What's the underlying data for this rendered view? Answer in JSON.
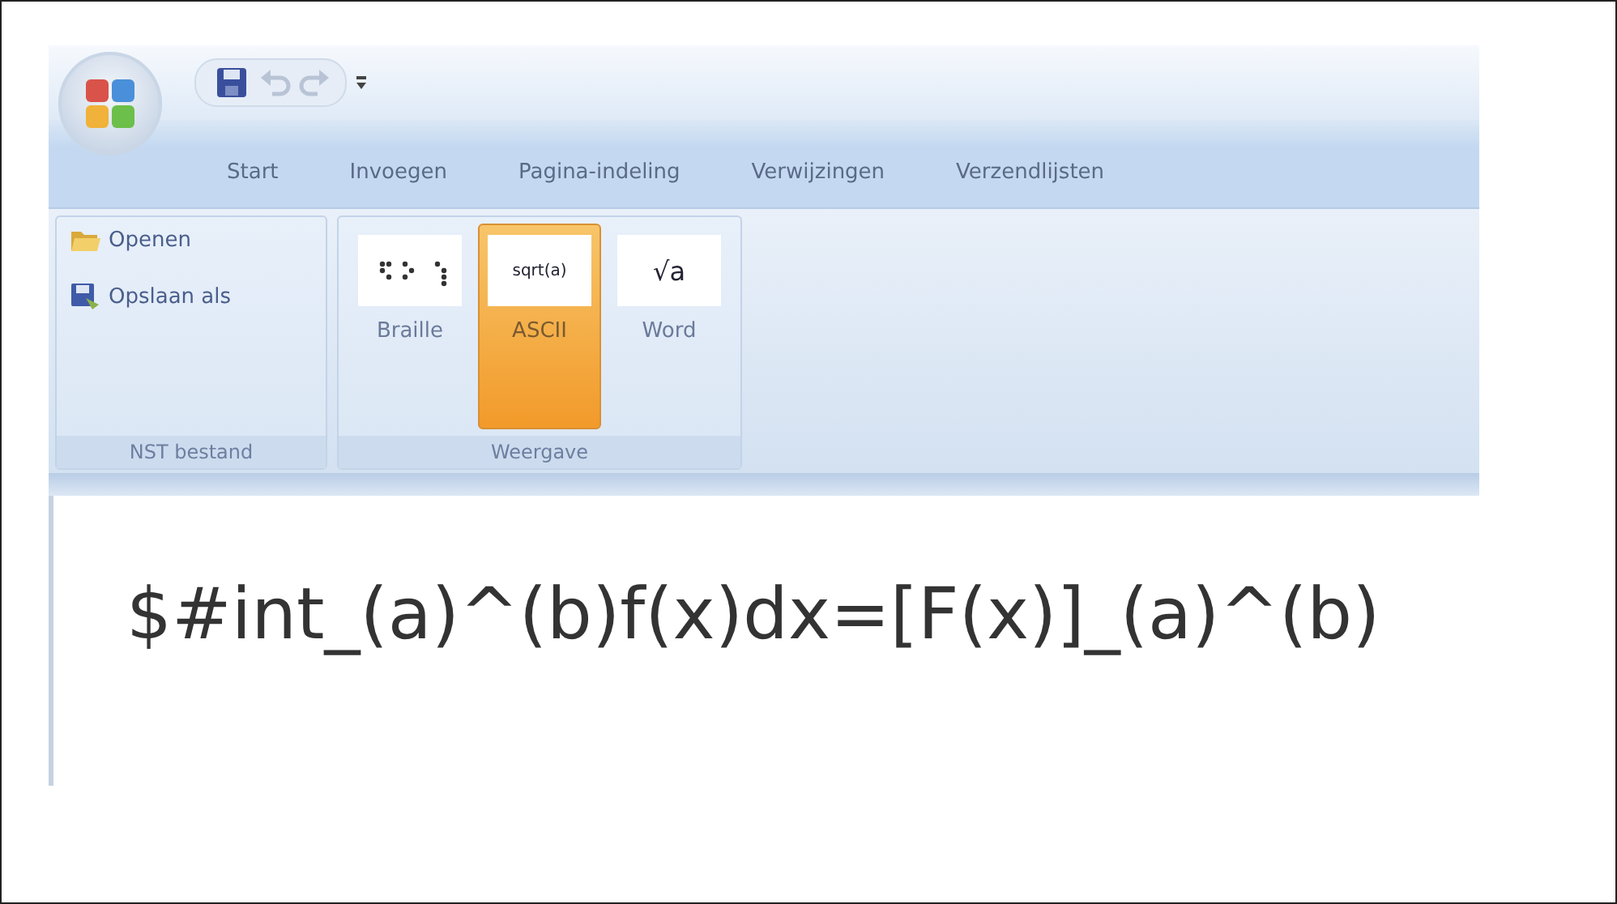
{
  "quick_access": [
    {
      "kind": "save",
      "disabled": false
    },
    {
      "kind": "undo",
      "disabled": true
    },
    {
      "kind": "redo",
      "disabled": true
    },
    {
      "kind": "customize",
      "disabled": false
    }
  ],
  "tabs": [
    {
      "label": "Start",
      "selected": false
    },
    {
      "label": "Invoegen",
      "selected": false
    },
    {
      "label": "Pagina-indeling",
      "selected": false
    },
    {
      "label": "Verwijzingen",
      "selected": false
    },
    {
      "label": "Verzendlijsten",
      "selected": false
    }
  ],
  "ribbon_groups": [
    {
      "label": "NST bestand",
      "kind": "list",
      "items": [
        {
          "label": "Openen",
          "kind": "open"
        },
        {
          "label": "Opslaan als",
          "kind": "save-as"
        }
      ]
    },
    {
      "label": "Weergave",
      "kind": "large",
      "items": [
        {
          "label": "Braille",
          "kind": "braille",
          "selected": false
        },
        {
          "label": "ASCII",
          "kind": "text",
          "preview": "sqrt(a)",
          "selected": true
        },
        {
          "label": "Word",
          "kind": "text",
          "preview": "√a",
          "selected": false
        }
      ]
    }
  ],
  "document": {
    "text": "$#int_(a)^(b)f(x)dx=[F(x)]_(a)^(b)"
  }
}
